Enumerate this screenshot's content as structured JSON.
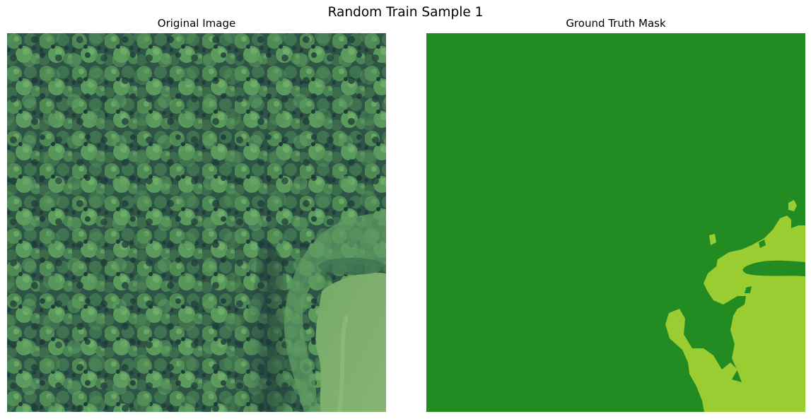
{
  "figure": {
    "title": "Random Train Sample 1"
  },
  "panels": [
    {
      "title": "Original Image"
    },
    {
      "title": "Ground Truth Mask"
    }
  ],
  "mask_colors": {
    "forest": "#228b22",
    "meadow": "#9acd32"
  },
  "photo_colors": {
    "canopy_dark": "#1e3f3b",
    "canopy_mid": "#3b6b4a",
    "canopy_light": "#5d9a5c",
    "meadow": "#7fae6e",
    "shadow": "#22403c"
  }
}
